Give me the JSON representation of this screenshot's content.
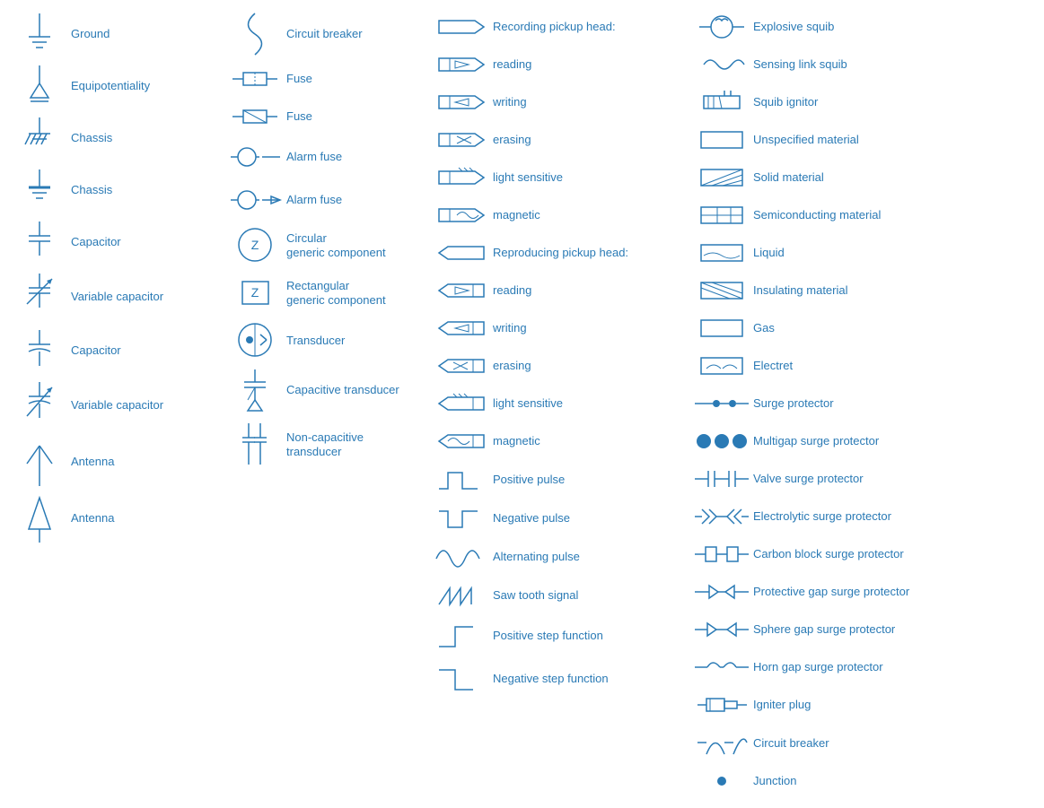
{
  "columns": [
    {
      "id": "col1",
      "items": [
        {
          "id": "ground",
          "label": "Ground"
        },
        {
          "id": "equipotentiality",
          "label": "Equipotentiality"
        },
        {
          "id": "chassis1",
          "label": "Chassis"
        },
        {
          "id": "chassis2",
          "label": "Chassis"
        },
        {
          "id": "capacitor1",
          "label": "Capacitor"
        },
        {
          "id": "variable-capacitor1",
          "label": "Variable capacitor"
        },
        {
          "id": "capacitor2",
          "label": "Capacitor"
        },
        {
          "id": "variable-capacitor2",
          "label": "Variable capacitor"
        },
        {
          "id": "antenna1",
          "label": "Antenna"
        },
        {
          "id": "antenna2",
          "label": "Antenna"
        }
      ]
    },
    {
      "id": "col2",
      "items": [
        {
          "id": "circuit-breaker",
          "label": "Circuit breaker"
        },
        {
          "id": "fuse1",
          "label": "Fuse"
        },
        {
          "id": "fuse2",
          "label": "Fuse"
        },
        {
          "id": "alarm-fuse1",
          "label": "Alarm fuse"
        },
        {
          "id": "alarm-fuse2",
          "label": "Alarm fuse"
        },
        {
          "id": "circular-generic",
          "label": "Circular\ngeneric component"
        },
        {
          "id": "rectangular-generic",
          "label": "Rectangular\ngeneric component"
        },
        {
          "id": "transducer",
          "label": "Transducer"
        },
        {
          "id": "capacitive-transducer",
          "label": "Capacitive transducer"
        },
        {
          "id": "non-capacitive-transducer",
          "label": "Non-capacitive\ntransducer"
        }
      ]
    },
    {
      "id": "col3",
      "items": [
        {
          "id": "rec-reading",
          "label": "Recording pickup head:"
        },
        {
          "id": "rec-reading-sub",
          "label": "reading"
        },
        {
          "id": "rec-writing",
          "label": "writing"
        },
        {
          "id": "rec-erasing",
          "label": "erasing"
        },
        {
          "id": "rec-light",
          "label": "light sensitive"
        },
        {
          "id": "rec-magnetic",
          "label": "magnetic"
        },
        {
          "id": "rep-head",
          "label": "Reproducing pickup head:"
        },
        {
          "id": "rep-reading",
          "label": "reading"
        },
        {
          "id": "rep-writing",
          "label": "writing"
        },
        {
          "id": "rep-erasing",
          "label": "erasing"
        },
        {
          "id": "rep-light",
          "label": "light sensitive"
        },
        {
          "id": "rep-magnetic",
          "label": "magnetic"
        },
        {
          "id": "positive-pulse",
          "label": "Positive pulse"
        },
        {
          "id": "negative-pulse",
          "label": "Negative pulse"
        },
        {
          "id": "alternating-pulse",
          "label": "Alternating pulse"
        },
        {
          "id": "saw-tooth",
          "label": "Saw tooth signal"
        },
        {
          "id": "positive-step",
          "label": "Positive step function"
        },
        {
          "id": "negative-step",
          "label": "Negative step function"
        }
      ]
    },
    {
      "id": "col4",
      "items": [
        {
          "id": "explosive-squib",
          "label": "Explosive squib"
        },
        {
          "id": "sensing-link-squib",
          "label": "Sensing link squib"
        },
        {
          "id": "squib-ignitor",
          "label": "Squib ignitor"
        },
        {
          "id": "unspecified-material",
          "label": "Unspecified material"
        },
        {
          "id": "solid-material",
          "label": "Solid material"
        },
        {
          "id": "semiconducting-material",
          "label": "Semiconducting material"
        },
        {
          "id": "liquid",
          "label": "Liquid"
        },
        {
          "id": "insulating-material",
          "label": "Insulating material"
        },
        {
          "id": "gas",
          "label": "Gas"
        },
        {
          "id": "electret",
          "label": "Electret"
        },
        {
          "id": "surge-protector",
          "label": "Surge protector"
        },
        {
          "id": "multigap-surge",
          "label": "Multigap surge protector"
        },
        {
          "id": "valve-surge",
          "label": "Valve surge protector"
        },
        {
          "id": "electrolytic-surge",
          "label": "Electrolytic surge protector"
        },
        {
          "id": "carbon-block-surge",
          "label": "Carbon block surge protector"
        },
        {
          "id": "protective-gap-surge",
          "label": "Protective gap surge protector"
        },
        {
          "id": "sphere-gap-surge",
          "label": "Sphere gap surge protector"
        },
        {
          "id": "horn-gap-surge",
          "label": "Horn gap surge protector"
        },
        {
          "id": "igniter-plug",
          "label": "Igniter plug"
        },
        {
          "id": "circuit-breaker2",
          "label": "Circuit breaker"
        },
        {
          "id": "junction",
          "label": "Junction"
        }
      ]
    }
  ]
}
